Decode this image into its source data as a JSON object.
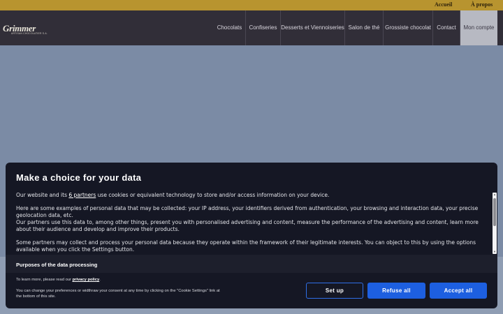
{
  "topbar": {
    "links": [
      "Accueil",
      "À propos"
    ]
  },
  "logo": {
    "brand": "Grimmer",
    "tagline": "ARTISAN CHOCOLATIER S.A."
  },
  "nav": {
    "items": [
      "Chocolats",
      "Confiseries",
      "Desserts et Viennoiseries",
      "Salon de thé",
      "Grossiste chocolat",
      "Contact",
      "Mon compte"
    ]
  },
  "modal": {
    "title": "Make a choice for your data",
    "intro_prefix": "Our website and its ",
    "intro_link": "6 partners",
    "intro_suffix": " use cookies or equivalent technology to store and/or access information on your device.",
    "examples": "Here are some examples of personal data that may be collected: your IP address, your identifiers derived from authentication, your browsing and interaction data, your precise geolocation data, etc.",
    "use": "Our partners use this data to, among other things, present you with personalised advertising and content, measure the performance of the advertising and content, learn more about their audience and develop and improve their products.",
    "legit": "Some partners may collect and process your personal data because they operate within the framework of their legitimate interests. You can object to this by using the options available when you click the Settings button.",
    "purposes_heading": "Purposes of the data processing",
    "privacy_prefix": "To learn more, please read our ",
    "privacy_link": "privacy policy",
    "privacy_suffix": ".",
    "change_note": "You can change your preferences or widthraw your consent at any time by clicking on the \"Cookie Settings\" link at the bottom of this site.",
    "buttons": {
      "setup": "Set up",
      "refuse": "Refuse all",
      "accept": "Accept all"
    }
  },
  "colors": {
    "gold_bar": "#b8942f",
    "nav_bg": "#312e38",
    "modal_bg": "#151724",
    "button_blue": "#1d5fe0"
  }
}
